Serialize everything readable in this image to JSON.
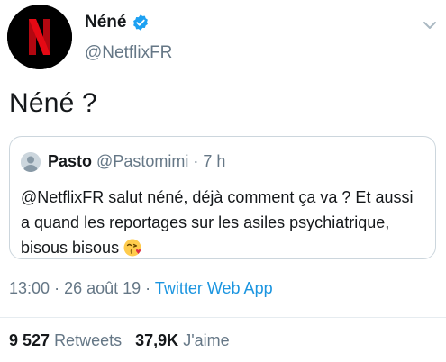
{
  "author": {
    "display_name": "Néné",
    "handle": "@NetflixFR",
    "avatar_icon": "netflix-n-logo",
    "verified": true,
    "brand_color": "#e50914",
    "verified_color": "#1da1f2"
  },
  "tweet": {
    "text": "Néné ?"
  },
  "quoted_tweet": {
    "display_name": "Pasto",
    "handle": "@Pastomimi",
    "separator": "·",
    "time": "7 h",
    "text": "@NetflixFR salut néné, déjà comment ça va ? Et aussi a quand les reportages sur les asiles psychiatrique, bisous bisous",
    "emoji": "😘"
  },
  "meta": {
    "time": "13:00",
    "separator1": "·",
    "date": "26 août 19",
    "separator2": "·",
    "source": "Twitter Web App",
    "link_color": "#1b95e0"
  },
  "stats": {
    "retweets_count": "9 527",
    "retweets_label": "Retweets",
    "likes_count": "37,9K",
    "likes_label": "J'aime"
  }
}
